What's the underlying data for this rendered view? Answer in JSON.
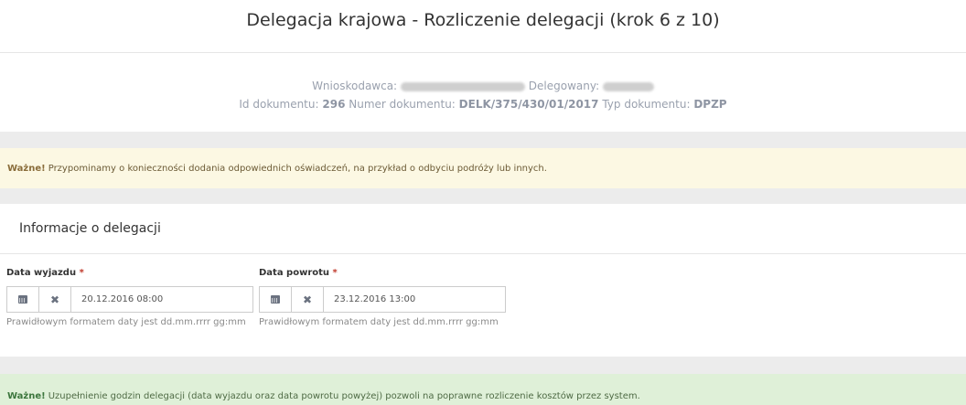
{
  "page": {
    "title": "Delegacja krajowa - Rozliczenie delegacji (krok 6 z 10)"
  },
  "meta": {
    "applicant_label": "Wnioskodawca:",
    "delegated_label": "Delegowany:",
    "doc_id_label": "Id dokumentu:",
    "doc_id": "296",
    "doc_number_label": "Numer dokumentu:",
    "doc_number": "DELK/375/430/01/2017",
    "doc_type_label": "Typ dokumentu:",
    "doc_type": "DPZP"
  },
  "alert_warning": {
    "strong": "Ważne!",
    "text": "Przypominamy o konieczności dodania odpowiednich oświadczeń, na przykład o odbyciu podróży lub innych."
  },
  "panel": {
    "title": "Informacje o delegacji"
  },
  "departure": {
    "label": "Data wyjazdu",
    "required": "*",
    "value": "20.12.2016 08:00",
    "help": "Prawidłowym formatem daty jest dd.mm.rrrr gg:mm"
  },
  "return": {
    "label": "Data powrotu",
    "required": "*",
    "value": "23.12.2016 13:00",
    "help": "Prawidłowym formatem daty jest dd.mm.rrrr gg:mm"
  },
  "alert_success": {
    "strong": "Ważne!",
    "text": "Uzupełnienie godzin delegacji (data wyjazdu oraz data powrotu powyżej) pozwoli na poprawne rozliczenie kosztów przez system."
  },
  "icons": {
    "calendar": "calendar-icon",
    "clear": "close-icon"
  },
  "colors": {
    "warning_bg": "#fcf8e3",
    "success_bg": "#dff0d8",
    "required": "#c0392b"
  }
}
